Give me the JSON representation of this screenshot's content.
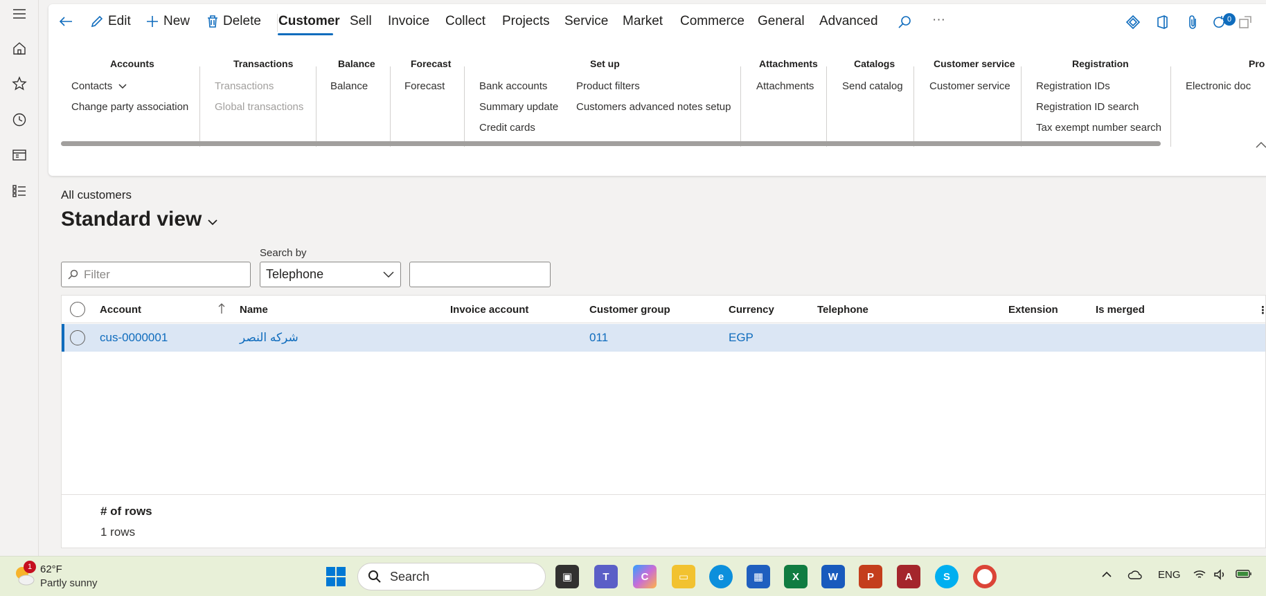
{
  "toolbar": {
    "edit": "Edit",
    "new": "New",
    "delete": "Delete",
    "tabs": [
      "Customer",
      "Sell",
      "Invoice",
      "Collect",
      "Projects",
      "Service",
      "Market",
      "Commerce",
      "General",
      "Advanced"
    ],
    "more": "···",
    "notification_count": "0"
  },
  "ribbon": {
    "accounts": {
      "title": "Accounts",
      "items": [
        "Contacts",
        "Change party association"
      ]
    },
    "transactions": {
      "title": "Transactions",
      "items": [
        "Transactions",
        "Global transactions"
      ]
    },
    "balance": {
      "title": "Balance",
      "items": [
        "Balance"
      ]
    },
    "forecast": {
      "title": "Forecast",
      "items": [
        "Forecast"
      ]
    },
    "setup": {
      "title": "Set up",
      "items": [
        "Bank accounts",
        "Summary update",
        "Credit cards",
        "Product filters",
        "Customers advanced notes setup"
      ]
    },
    "attachments": {
      "title": "Attachments",
      "items": [
        "Attachments"
      ]
    },
    "catalogs": {
      "title": "Catalogs",
      "items": [
        "Send catalog"
      ]
    },
    "customer_service": {
      "title": "Customer service",
      "items": [
        "Customer service"
      ]
    },
    "registration": {
      "title": "Registration",
      "items": [
        "Registration IDs",
        "Registration ID search",
        "Tax exempt number search"
      ]
    },
    "pro": {
      "title": "Pro",
      "items": [
        "Electronic doc"
      ]
    }
  },
  "page": {
    "breadcrumb": "All customers",
    "view": "Standard view"
  },
  "filters": {
    "filter_placeholder": "Filter",
    "search_by_label": "Search by",
    "search_by_value": "Telephone",
    "search_value": ""
  },
  "grid": {
    "columns": [
      "Account",
      "Name",
      "Invoice account",
      "Customer group",
      "Currency",
      "Telephone",
      "Extension",
      "Is merged"
    ],
    "rows": [
      {
        "account": "cus-0000001",
        "name": "شركه النصر",
        "invoice_account": "",
        "customer_group": "011",
        "currency": "EGP",
        "telephone": "",
        "extension": "",
        "is_merged": ""
      }
    ],
    "footer_label": "# of rows",
    "footer_value": "1 rows"
  },
  "taskbar": {
    "weather_temp": "62°F",
    "weather_desc": "Partly sunny",
    "weather_alert": "1",
    "search": "Search",
    "lang": "ENG"
  },
  "colors": {
    "accent": "#0f6cbd",
    "selected_row": "#dbe6f4",
    "taskbar": "#e8f0d8"
  }
}
